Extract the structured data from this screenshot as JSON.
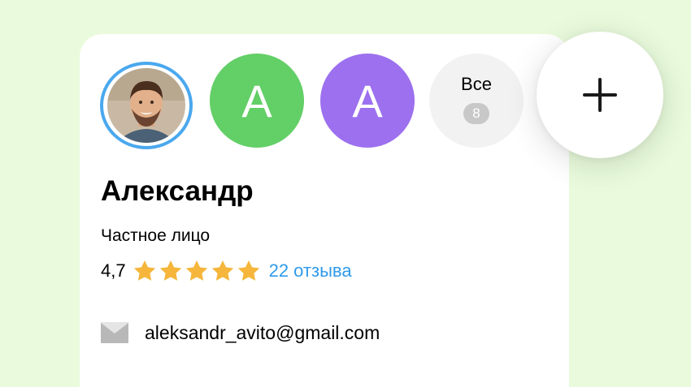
{
  "profile": {
    "name": "Александр",
    "seller_type": "Частное лицо",
    "rating": "4,7",
    "stars_filled": 5,
    "reviews_label": "22 отзыва",
    "email": "aleksandr_avito@gmail.com"
  },
  "accounts": {
    "items": [
      {
        "letter": "A",
        "color": "#63cf67"
      },
      {
        "letter": "A",
        "color": "#9c70ee"
      }
    ],
    "all_label": "Все",
    "all_count": "8",
    "selected_ring_color": "#4aa8ee"
  },
  "colors": {
    "background": "#e9fbdc",
    "star": "#f5b63b",
    "link": "#2f9bec",
    "icon_gray": "#b8b8b8"
  },
  "icons": {
    "add": "plus-icon",
    "email": "envelope-icon",
    "star": "star-icon"
  }
}
